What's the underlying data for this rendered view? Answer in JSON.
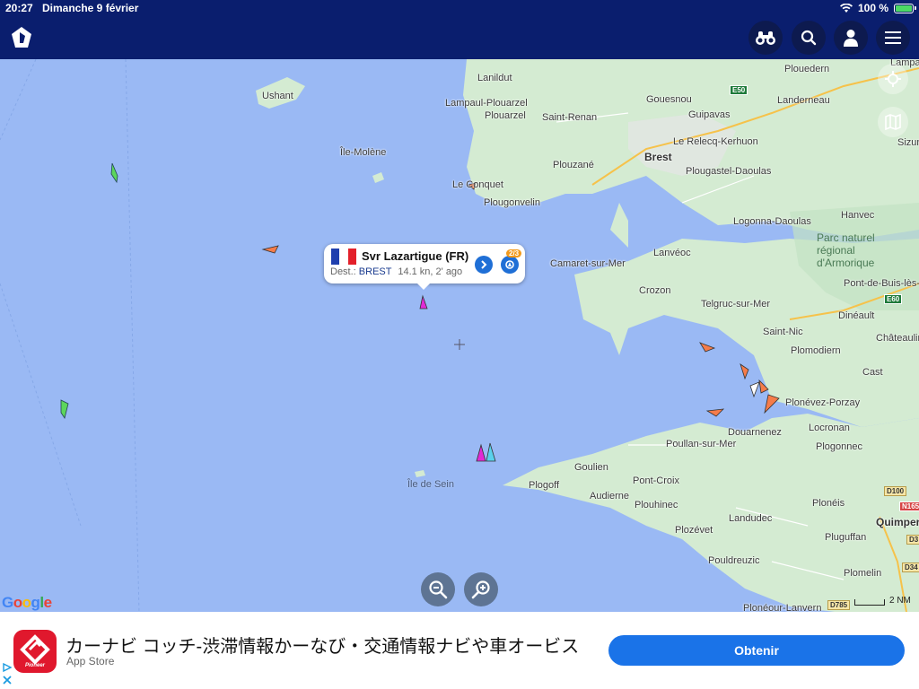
{
  "status": {
    "time": "20:27",
    "date": "Dimanche 9 février",
    "battery": "100 %",
    "battery_level": 1.0
  },
  "header": {
    "app_icon": "marinetraffic-logo-icon",
    "buttons": [
      "binoculars-icon",
      "search-icon",
      "user-icon",
      "menu-icon"
    ]
  },
  "map": {
    "places": {
      "ushant": "Ushant",
      "ile_molene": "Île-Molène",
      "lanildut": "Lanildut",
      "lampaul": "Lampaul-Plouarzel",
      "plouarzel": "Plouarzel",
      "saint_renan": "Saint-Renan",
      "gouesnou": "Gouesnou",
      "guipavas": "Guipavas",
      "landerneau": "Landerneau",
      "plouedern": "Plouedern",
      "brest": "Brest",
      "relecq": "Le Relecq-Kerhuon",
      "plouzane": "Plouzané",
      "plougastel": "Plougastel-Daoulas",
      "le_conquet": "Le Conquet",
      "plougonvelin": "Plougonvelin",
      "logonna": "Logonna-Daoulas",
      "hanvec": "Hanvec",
      "sizun": "Sizun",
      "lampa": "Lampa",
      "park": "Parc naturel\nrégional\nd'Armorique",
      "camaret": "Camaret-sur-Mer",
      "lanveoc": "Lanvéoc",
      "crozon": "Crozon",
      "telgruc": "Telgruc-sur-Mer",
      "pont_buis": "Pont-de-Buis-lès-",
      "dineault": "Dinéault",
      "saint_nic": "Saint-Nic",
      "chateaulin": "Châteaulin",
      "plomodiern": "Plomodiern",
      "cast": "Cast",
      "plonevez": "Plonévez-Porzay",
      "locronan": "Locronan",
      "douarnenez": "Douarnenez",
      "poullan": "Poullan-sur-Mer",
      "plogonnec": "Plogonnec",
      "goulien": "Goulien",
      "pont_croix": "Pont-Croix",
      "plogoff": "Plogoff",
      "audierne": "Audierne",
      "plouhinec": "Plouhinec",
      "ile_sein": "Île de Sein",
      "landudec": "Landudec",
      "plonéis": "Plonéis",
      "quimper": "Quimper",
      "plozevet": "Plozévet",
      "pluguffan": "Pluguffan",
      "pouldreuzic": "Pouldreuzic",
      "plomelin": "Plomelin",
      "ploneour": "Plonéour-Lanvern"
    },
    "roads": {
      "e50": "E50",
      "e60": "E60",
      "d100": "D100",
      "n165": "N165",
      "d785": "D785",
      "d3": "D3",
      "d34": "D34"
    },
    "scale_label": "2 NM",
    "attribution": "Google"
  },
  "vessel_popup": {
    "name": "Svr Lazartigue (FR)",
    "dest_label": "Dest.:",
    "destination": "BREST",
    "speed_age": "14.1 kn, 2' ago",
    "badge": "2/3",
    "flag_colors": [
      "#1f3fae",
      "#ffffff",
      "#e3202a"
    ]
  },
  "ad": {
    "title": "カーナビ コッチ-渋滞情報かーなび・交通情報ナビや車オービス",
    "store": "App Store",
    "button": "Obtenir",
    "icon_label": "Pioneer"
  },
  "colors": {
    "sea": "#9ab9f4",
    "land": "#d4ebd2",
    "header": "#0a1e6e",
    "accent": "#1a73e8"
  }
}
